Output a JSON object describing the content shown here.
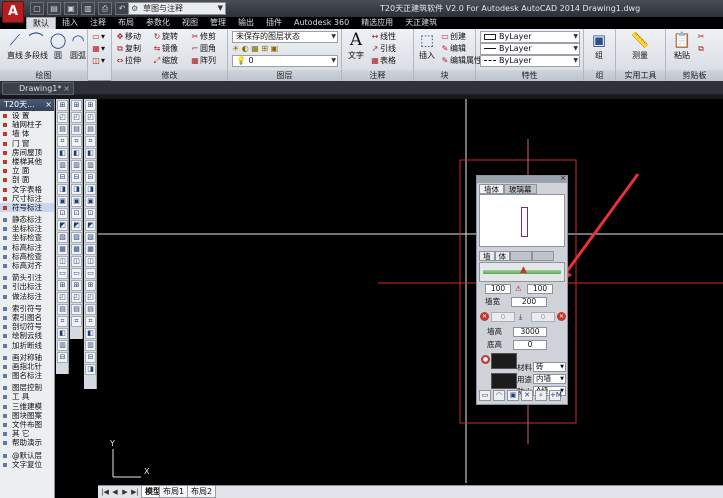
{
  "app": {
    "logo": "A",
    "workspace": "草图与注释",
    "title": "T20天正建筑软件 V2.0 For Autodesk AutoCAD 2014    Drawing1.dwg"
  },
  "ribbon_tabs": [
    "默认",
    "插入",
    "注释",
    "布局",
    "参数化",
    "视图",
    "管理",
    "输出",
    "插件",
    "Autodesk 360",
    "精选应用",
    "天正建筑"
  ],
  "ribbon": {
    "draw": {
      "title": "绘图",
      "line": "直线",
      "polyline": "多段线",
      "circle": "圆",
      "arc": "圆弧"
    },
    "modify": {
      "title": "修改",
      "move": "移动",
      "rotate": "旋转",
      "trim": "修剪",
      "copy": "复制",
      "mirror": "镜像",
      "fillet": "圆角",
      "stretch": "拉伸",
      "scale": "缩放",
      "array": "阵列"
    },
    "layers": {
      "title": "图层",
      "state": "未保存的图层状态",
      "current": "0"
    },
    "annotation": {
      "title": "注释",
      "text": "文字",
      "linear": "线性",
      "leader": "引线",
      "table": "表格"
    },
    "block": {
      "title": "块",
      "insert": "插入",
      "create": "创建",
      "edit": "编辑",
      "edit_attr": "编辑属性"
    },
    "properties": {
      "title": "特性",
      "color": "ByLayer",
      "linetype": "ByLayer",
      "lineweight": "ByLayer"
    },
    "group": {
      "title": "组",
      "label": "组"
    },
    "utilities": {
      "title": "实用工具",
      "measure": "测量"
    },
    "clipboard": {
      "title": "剪贴板",
      "paste": "粘贴"
    }
  },
  "file_tab": "Drawing1*",
  "t20": {
    "title": "T20天...",
    "items": [
      "设  置",
      "轴网柱子",
      "墙  体",
      "门  窗",
      "房间屋顶",
      "楼梯其他",
      "立  面",
      "剖  面",
      "文字表格",
      "尺寸标注",
      "符号标注",
      "静态标注",
      "坐标标注",
      "坐标检查",
      "标高标注",
      "标高检查",
      "标高对齐",
      "箭头引注",
      "引出标注",
      "做法标注",
      "索引符号",
      "索引图名",
      "剖切符号",
      "绘制云线",
      "加折断线",
      "画对称轴",
      "画指北针",
      "图名标注",
      "图层控制",
      "工  具",
      "三维建模",
      "图块图案",
      "文件布图",
      "其  它",
      "帮助演示"
    ],
    "bottom": [
      "@默认层",
      "文字复位"
    ]
  },
  "layout_tabs": [
    "模型",
    "布局1",
    "布局2"
  ],
  "ucs": {
    "x": "X",
    "y": "Y"
  },
  "wall_panel": {
    "tabs": [
      "墙体",
      "玻璃幕"
    ],
    "subtabs": [
      "墙",
      "体"
    ],
    "left_width": "100",
    "right_width": "100",
    "wall_width_label": "墙宽",
    "wall_width": "200",
    "left_offset": "0",
    "right_offset": "0",
    "height_label": "墙高",
    "height": "3000",
    "base_label": "底高",
    "base": "0",
    "material_label": "材料",
    "material": "砖",
    "use_label": "用途",
    "use": "内墙",
    "fire_label": "防火",
    "fire": "A级"
  },
  "colors": {
    "canvas": "#000000",
    "crosshair": "#e6e6e6",
    "red_lines": "#cc2b2b",
    "accent_red": "#e8313a"
  }
}
